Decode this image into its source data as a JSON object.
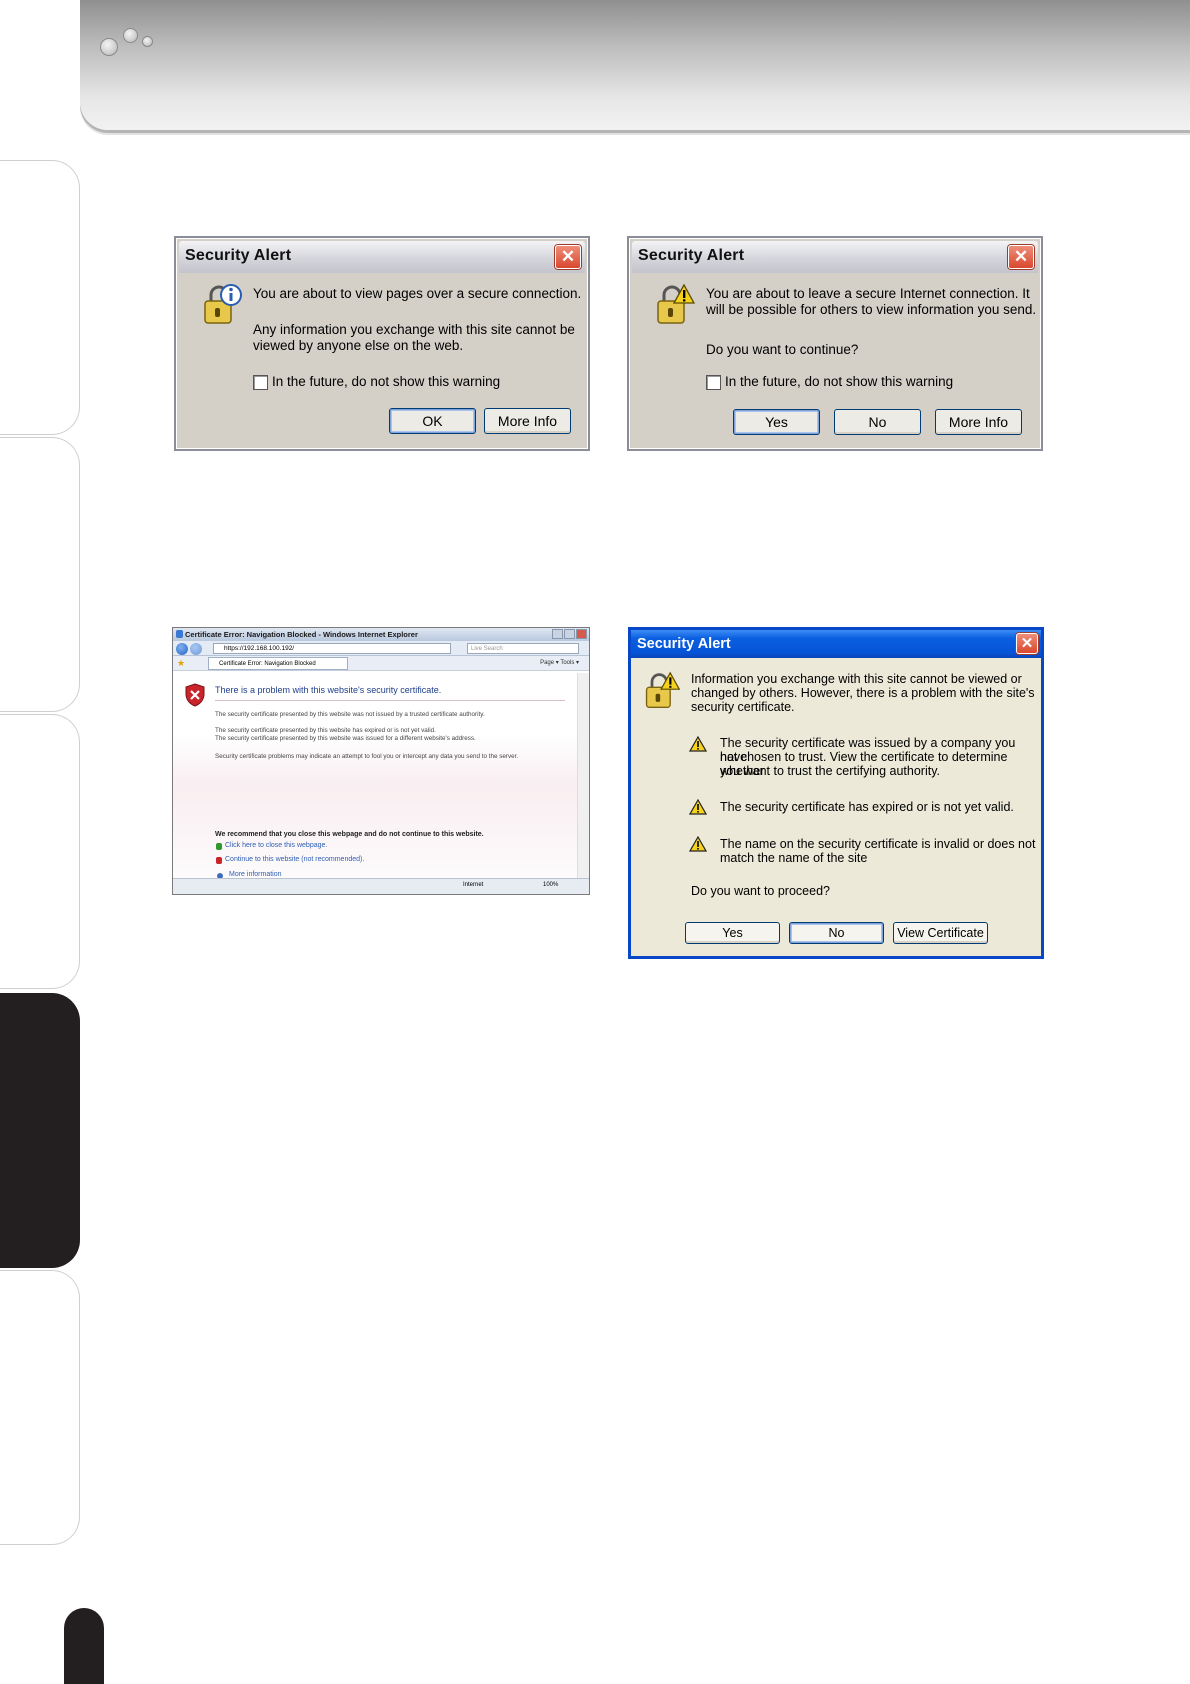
{
  "dialog_secure_enter": {
    "title": "Security Alert",
    "line1": "You are about to view pages over a secure connection.",
    "line2": "Any information you exchange with this site cannot be",
    "line3": "viewed by anyone else on the web.",
    "checkbox_label": "In the future, do not show this warning",
    "ok_label": "OK",
    "more_info_label": "More Info"
  },
  "dialog_secure_leave": {
    "title": "Security Alert",
    "line1": "You are about to leave a secure Internet connection.  It",
    "line2": "will be possible for others to view information you send.",
    "question": "Do you want to continue?",
    "checkbox_label": "In the future, do not show this warning",
    "yes_label": "Yes",
    "no_label": "No",
    "more_info_label": "More Info"
  },
  "ie_window": {
    "title": "Certificate Error: Navigation Blocked - Windows Internet Explorer",
    "address": "https://192.168.100.192/",
    "search_placeholder": "Live Search",
    "tab_label": "Certificate Error: Navigation Blocked",
    "tools_label": "Page ▾  Tools ▾",
    "heading": "There is a problem with this website's security certificate.",
    "p1": "The security certificate presented by this website was not issued by a trusted certificate authority.",
    "p2": "The security certificate presented by this website has expired or is not yet valid.",
    "p3": "The security certificate presented by this website was issued for a different website's address.",
    "p4": "Security certificate problems may indicate an attempt to fool you or intercept any data you send to the server.",
    "recommend": "We recommend that you close this webpage and do not continue to this website.",
    "link_close": "Click here to close this webpage.",
    "link_continue": "Continue to this website (not recommended).",
    "link_more": "More information",
    "status_zone": "Internet",
    "status_zoom": "100%"
  },
  "dialog_cert": {
    "title": "Security Alert",
    "intro1": "Information you exchange with this site cannot be viewed or",
    "intro2": "changed by others. However, there is a problem with the site's",
    "intro3": "security certificate.",
    "w1a": "The security certificate was issued by a company you have",
    "w1b": "not chosen to trust. View the certificate to determine whether",
    "w1c": "you want to trust the certifying authority.",
    "w2": "The security certificate has expired or is not yet valid.",
    "w3a": "The name on the security certificate is invalid or does not",
    "w3b": "match the name of the site",
    "question": "Do you want to proceed?",
    "yes_label": "Yes",
    "no_label": "No",
    "view_cert_label": "View Certificate"
  }
}
